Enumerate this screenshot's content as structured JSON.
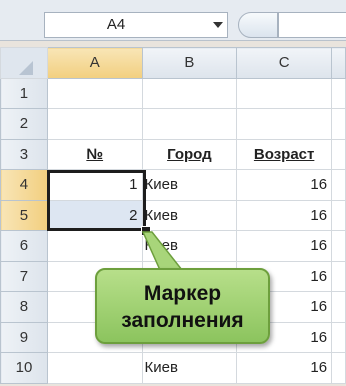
{
  "name_box": {
    "value": "A4"
  },
  "columns": [
    "A",
    "B",
    "C"
  ],
  "rows": [
    {
      "num": "1",
      "a": "",
      "b": "",
      "c": ""
    },
    {
      "num": "2",
      "a": "",
      "b": "",
      "c": ""
    },
    {
      "num": "3",
      "a": "№",
      "b": "Город",
      "c": "Возраст"
    },
    {
      "num": "4",
      "a": "1",
      "b": "Киев",
      "c": "16"
    },
    {
      "num": "5",
      "a": "2",
      "b": "Киев",
      "c": "16"
    },
    {
      "num": "6",
      "a": "",
      "b": "Киев",
      "c": "16"
    },
    {
      "num": "7",
      "a": "",
      "b": "",
      "c": "16"
    },
    {
      "num": "8",
      "a": "",
      "b": "",
      "c": "16"
    },
    {
      "num": "9",
      "a": "",
      "b": "",
      "c": "16"
    },
    {
      "num": "10",
      "a": "",
      "b": "Киев",
      "c": "16"
    }
  ],
  "callout": {
    "line1": "Маркер",
    "line2": "заполнения"
  },
  "colors": {
    "selection": "#1d1d1d",
    "callout_fill": "#a3d274",
    "active_header": "#f2cf7f"
  }
}
